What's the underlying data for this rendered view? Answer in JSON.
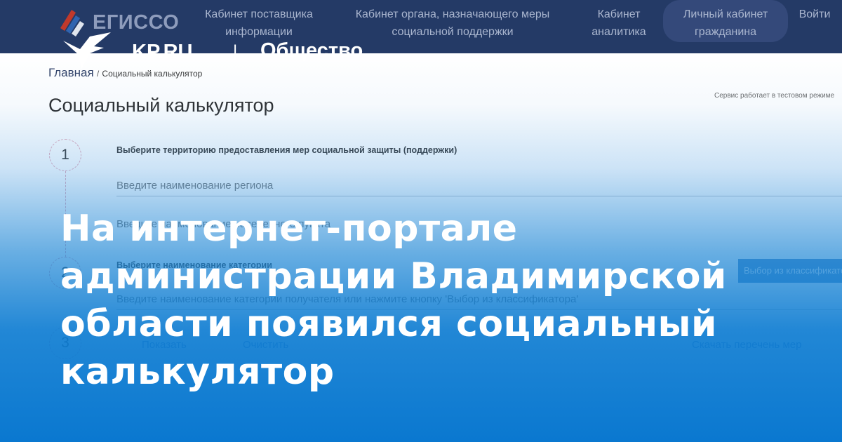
{
  "egisso": {
    "logo_text": "ЕГИССО",
    "nav": [
      "Кабинет поставщика информации",
      "Кабинет органа, назначающего меры социальной поддержки",
      "Кабинет аналитика",
      "Личный кабинет гражданина",
      "Войти"
    ],
    "breadcrumb": {
      "home": "Главная",
      "sep": "/",
      "current": "Социальный калькулятор"
    },
    "page_title": "Социальный калькулятор",
    "test_note": "Сервис работает в тестовом режиме",
    "steps": [
      {
        "number": "1",
        "title": "Выберите территорию предоставления мер социальной защиты (поддержки)",
        "region_placeholder": "Введите наименование региона",
        "locality_placeholder": "Введите наименование населенного пункта"
      },
      {
        "number": "2",
        "title": "Выберите наименование категории",
        "classifier_button": "Выбор из классификатора",
        "category_placeholder": "Введите наименование категории получателя или нажмите кнопку 'Выбор из классификатора'"
      },
      {
        "number": "3"
      }
    ],
    "actions": {
      "show": "Показать",
      "clear": "Очистить",
      "download": "Скачать перечень мер"
    }
  },
  "kp": {
    "brand": "KP.RU",
    "separator": "|",
    "section": "Общество",
    "headline": "На интернет-портале администрации Владимирской области появился социальный калькулятор"
  },
  "colors": {
    "nav_bg": "#243a66",
    "overlay_blue": "#0a78d0",
    "link_blue": "#3d6fb8"
  }
}
